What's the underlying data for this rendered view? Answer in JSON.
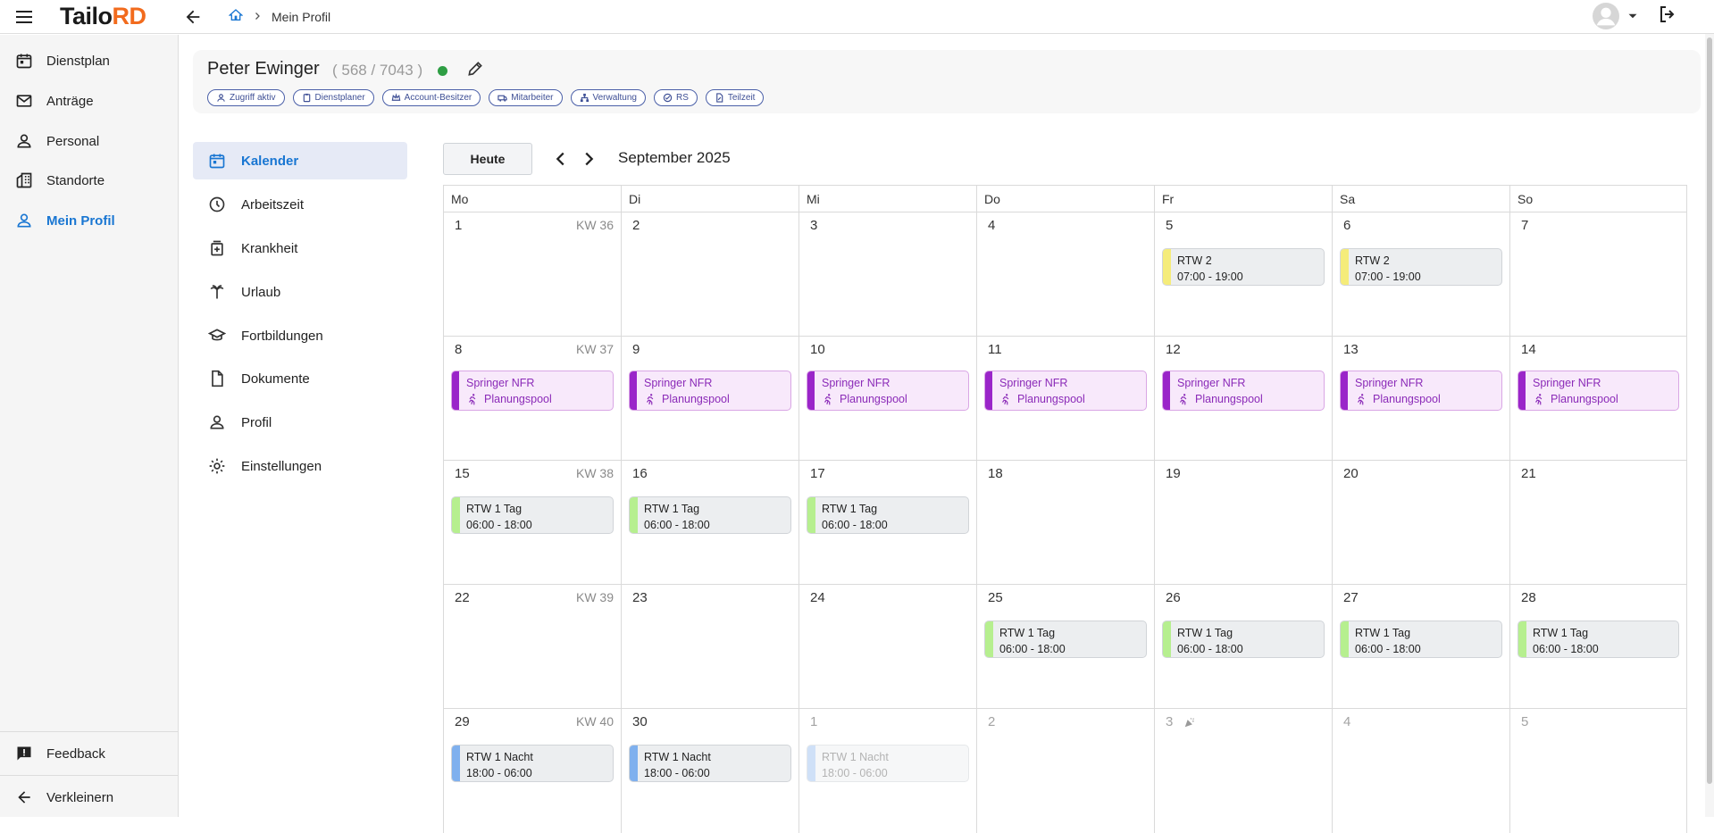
{
  "app": {
    "logo_part1": "Tailo",
    "logo_part2": "RD"
  },
  "breadcrumb": {
    "current": "Mein Profil"
  },
  "sidebar": {
    "items": [
      {
        "label": "Dienstplan",
        "icon": "calendar-icon"
      },
      {
        "label": "Anträge",
        "icon": "mail-icon"
      },
      {
        "label": "Personal",
        "icon": "person-icon"
      },
      {
        "label": "Standorte",
        "icon": "building-icon"
      },
      {
        "label": "Mein Profil",
        "icon": "person-icon",
        "active": true
      }
    ],
    "feedback_label": "Feedback",
    "collapse_label": "Verkleinern"
  },
  "profile": {
    "name": "Peter Ewinger",
    "ids": "( 568 / 7043 )",
    "status_color": "#2e9e44",
    "tags": [
      "Zugriff aktiv",
      "Dienstplaner",
      "Account-Besitzer",
      "Mitarbeiter",
      "Verwaltung",
      "RS",
      "Teilzeit"
    ]
  },
  "profile_nav": {
    "items": [
      {
        "label": "Kalender",
        "icon": "calendar-icon",
        "active": true
      },
      {
        "label": "Arbeitszeit",
        "icon": "clock-icon"
      },
      {
        "label": "Krankheit",
        "icon": "medical-icon"
      },
      {
        "label": "Urlaub",
        "icon": "palm-icon"
      },
      {
        "label": "Fortbildungen",
        "icon": "graduation-icon"
      },
      {
        "label": "Dokumente",
        "icon": "document-icon"
      },
      {
        "label": "Profil",
        "icon": "person-icon"
      },
      {
        "label": "Einstellungen",
        "icon": "gear-icon"
      }
    ]
  },
  "calendar": {
    "today_label": "Heute",
    "month_title": "September 2025",
    "weekdays": [
      "Mo",
      "Di",
      "Mi",
      "Do",
      "Fr",
      "Sa",
      "So"
    ],
    "weeks": [
      {
        "kw": "KW 36",
        "days": [
          {
            "num": "1",
            "events": []
          },
          {
            "num": "2",
            "events": []
          },
          {
            "num": "3",
            "events": []
          },
          {
            "num": "4",
            "events": []
          },
          {
            "num": "5",
            "events": [
              {
                "type": "rtw",
                "title": "RTW 2",
                "time": "07:00 - 19:00",
                "color": "#f5ec7a"
              }
            ]
          },
          {
            "num": "6",
            "events": [
              {
                "type": "rtw",
                "title": "RTW 2",
                "time": "07:00 - 19:00",
                "color": "#f5ec7a"
              }
            ]
          },
          {
            "num": "7",
            "events": []
          }
        ]
      },
      {
        "kw": "KW 37",
        "days": [
          {
            "num": "8",
            "events": [
              {
                "type": "springer",
                "title": "Springer NFR",
                "sub": "Planungspool"
              }
            ]
          },
          {
            "num": "9",
            "events": [
              {
                "type": "springer",
                "title": "Springer NFR",
                "sub": "Planungspool"
              }
            ]
          },
          {
            "num": "10",
            "events": [
              {
                "type": "springer",
                "title": "Springer NFR",
                "sub": "Planungspool"
              }
            ]
          },
          {
            "num": "11",
            "events": [
              {
                "type": "springer",
                "title": "Springer NFR",
                "sub": "Planungspool"
              }
            ]
          },
          {
            "num": "12",
            "events": [
              {
                "type": "springer",
                "title": "Springer NFR",
                "sub": "Planungspool"
              }
            ]
          },
          {
            "num": "13",
            "events": [
              {
                "type": "springer",
                "title": "Springer NFR",
                "sub": "Planungspool"
              }
            ]
          },
          {
            "num": "14",
            "events": [
              {
                "type": "springer",
                "title": "Springer NFR",
                "sub": "Planungspool"
              }
            ]
          }
        ]
      },
      {
        "kw": "KW 38",
        "days": [
          {
            "num": "15",
            "events": [
              {
                "type": "rtw",
                "title": "RTW 1 Tag",
                "time": "06:00 - 18:00",
                "color": "#b6ef8f"
              }
            ]
          },
          {
            "num": "16",
            "events": [
              {
                "type": "rtw",
                "title": "RTW 1 Tag",
                "time": "06:00 - 18:00",
                "color": "#b6ef8f"
              }
            ]
          },
          {
            "num": "17",
            "events": [
              {
                "type": "rtw",
                "title": "RTW 1 Tag",
                "time": "06:00 - 18:00",
                "color": "#b6ef8f"
              }
            ]
          },
          {
            "num": "18",
            "events": []
          },
          {
            "num": "19",
            "events": []
          },
          {
            "num": "20",
            "events": []
          },
          {
            "num": "21",
            "events": []
          }
        ]
      },
      {
        "kw": "KW 39",
        "days": [
          {
            "num": "22",
            "events": []
          },
          {
            "num": "23",
            "events": []
          },
          {
            "num": "24",
            "events": []
          },
          {
            "num": "25",
            "events": [
              {
                "type": "rtw",
                "title": "RTW 1 Tag",
                "time": "06:00 - 18:00",
                "color": "#b6ef8f"
              }
            ]
          },
          {
            "num": "26",
            "events": [
              {
                "type": "rtw",
                "title": "RTW 1 Tag",
                "time": "06:00 - 18:00",
                "color": "#b6ef8f"
              }
            ]
          },
          {
            "num": "27",
            "events": [
              {
                "type": "rtw",
                "title": "RTW 1 Tag",
                "time": "06:00 - 18:00",
                "color": "#b6ef8f"
              }
            ]
          },
          {
            "num": "28",
            "events": [
              {
                "type": "rtw",
                "title": "RTW 1 Tag",
                "time": "06:00 - 18:00",
                "color": "#b6ef8f"
              }
            ]
          }
        ]
      },
      {
        "kw": "KW 40",
        "days": [
          {
            "num": "29",
            "events": [
              {
                "type": "rtw",
                "title": "RTW 1 Nacht",
                "time": "18:00 - 06:00",
                "color": "#7fb0ee"
              }
            ]
          },
          {
            "num": "30",
            "events": [
              {
                "type": "rtw",
                "title": "RTW 1 Nacht",
                "time": "18:00 - 06:00",
                "color": "#7fb0ee"
              }
            ]
          },
          {
            "num": "1",
            "out": true,
            "events": [
              {
                "type": "rtw",
                "title": "RTW 1 Nacht",
                "time": "18:00 - 06:00",
                "color": "#cfe0f7",
                "faded": true
              }
            ]
          },
          {
            "num": "2",
            "out": true,
            "events": []
          },
          {
            "num": "3",
            "out": true,
            "party": true,
            "events": []
          },
          {
            "num": "4",
            "out": true,
            "events": []
          },
          {
            "num": "5",
            "out": true,
            "events": []
          }
        ]
      }
    ]
  }
}
